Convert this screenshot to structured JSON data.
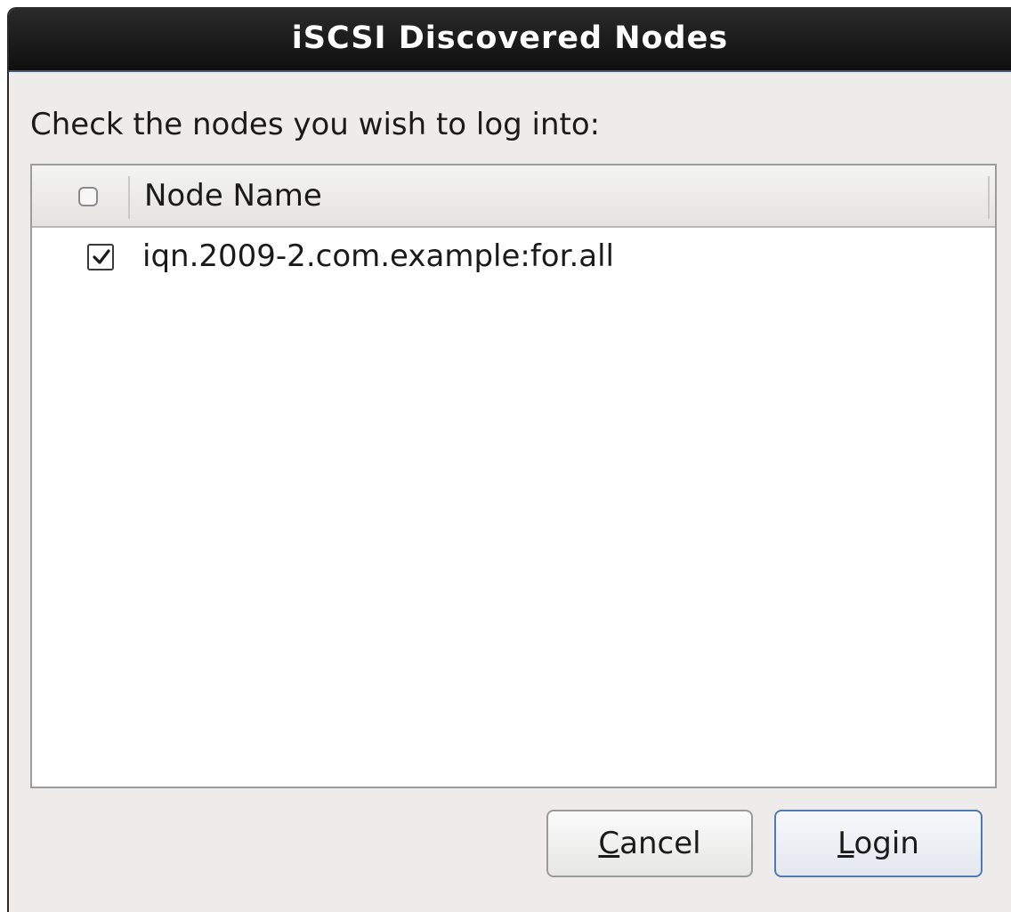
{
  "window": {
    "title": "iSCSI Discovered Nodes"
  },
  "prompt": "Check the nodes you wish to log into:",
  "list": {
    "header": {
      "select_all_checked": false,
      "column_label": "Node Name"
    },
    "rows": [
      {
        "checked": true,
        "node_name": "iqn.2009-2.com.example:for.all"
      }
    ]
  },
  "buttons": {
    "cancel": {
      "mnemonic": "C",
      "rest": "ancel"
    },
    "login": {
      "mnemonic": "L",
      "rest": "ogin"
    }
  },
  "colors": {
    "titlebar": "#1a1a1a",
    "dialog_bg": "#edeceb",
    "default_button_border": "#4f7ab5"
  },
  "icons": {
    "header_checkbox": "checkbox-unchecked-icon",
    "row_checkbox": "checkbox-checked-icon"
  }
}
